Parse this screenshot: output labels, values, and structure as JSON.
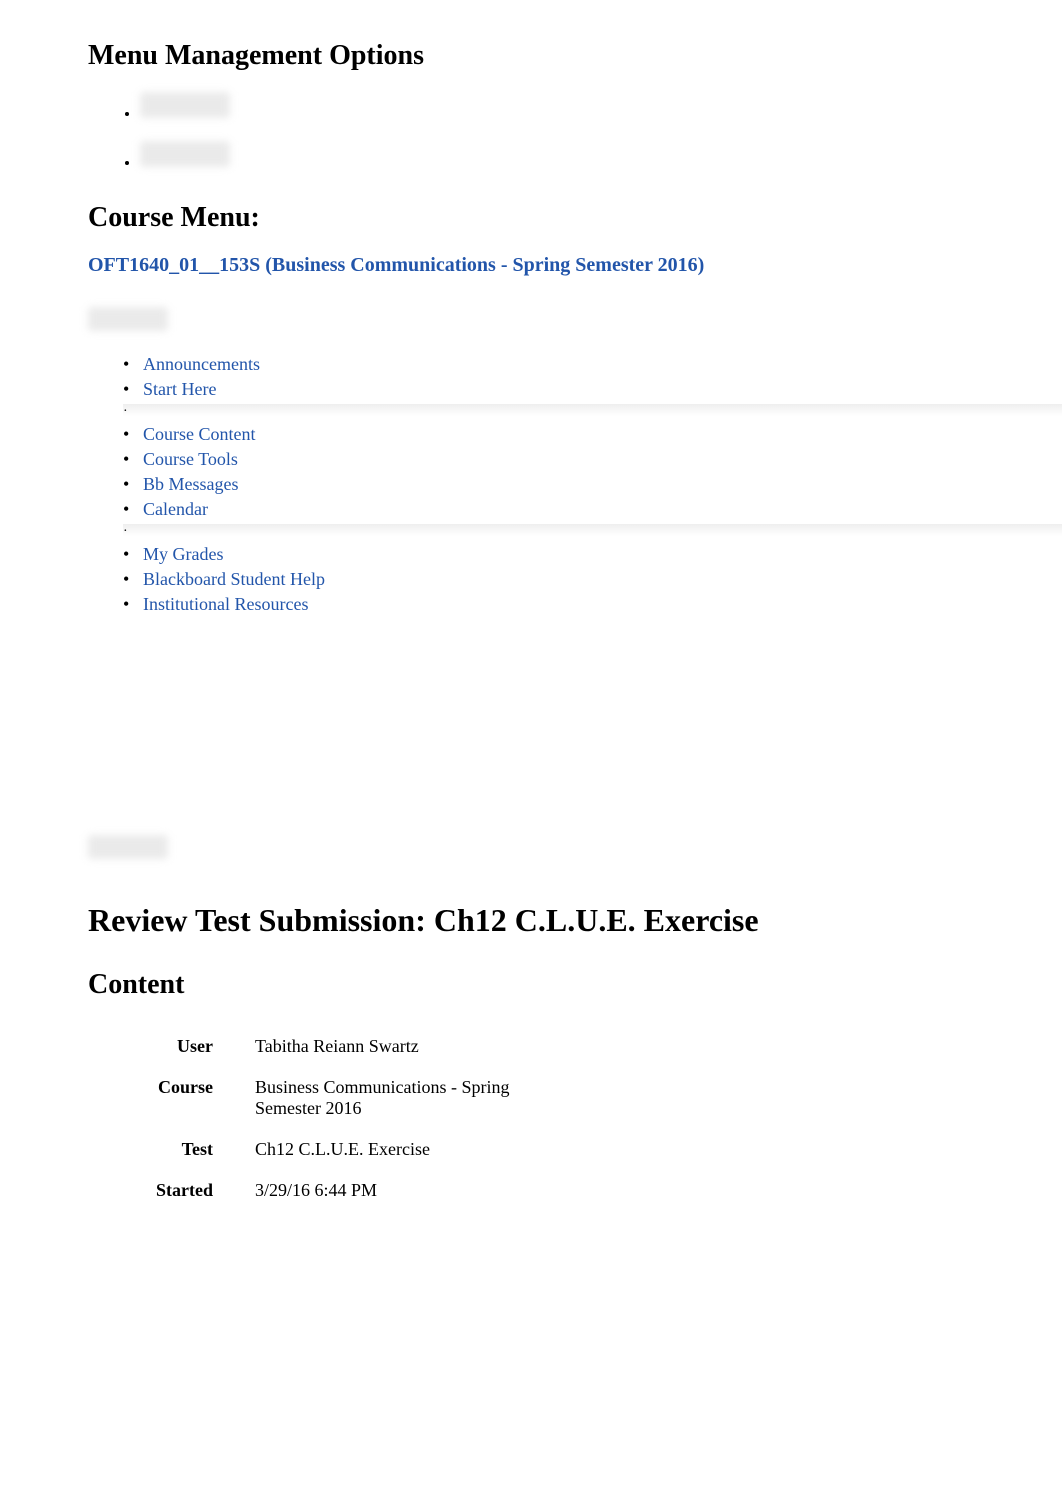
{
  "menuManagement": {
    "heading": "Menu Management Options"
  },
  "courseMenu": {
    "heading": "Course Menu:",
    "courseLink": "OFT1640_01__153S (Business Communications - Spring Semester 2016)",
    "items": [
      {
        "label": "Announcements"
      },
      {
        "label": "Start Here"
      },
      {
        "label": "Course Content"
      },
      {
        "label": "Course Tools"
      },
      {
        "label": "Bb Messages"
      },
      {
        "label": "Calendar"
      },
      {
        "label": "My Grades"
      },
      {
        "label": "Blackboard Student Help"
      },
      {
        "label": "Institutional Resources"
      }
    ]
  },
  "page": {
    "title": "Review Test Submission: Ch12 C.L.U.E. Exercise"
  },
  "content": {
    "heading": "Content",
    "rows": {
      "userLabel": "User",
      "userValue": "Tabitha Reiann Swartz",
      "courseLabel": "Course",
      "courseValue": "Business Communications - Spring Semester 2016",
      "testLabel": "Test",
      "testValue": "Ch12 C.L.U.E. Exercise",
      "startedLabel": "Started",
      "startedValue": "3/29/16 6:44 PM"
    }
  }
}
